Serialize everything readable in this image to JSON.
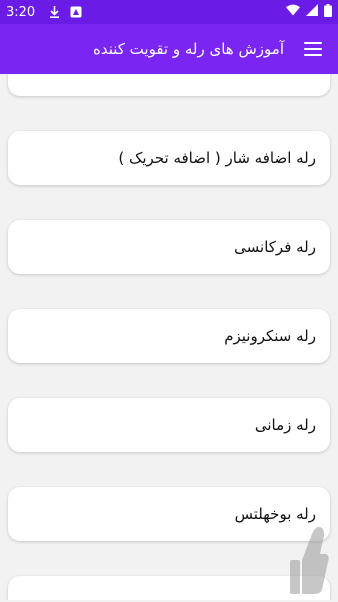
{
  "status_bar": {
    "time": "3:20",
    "icons": [
      "download-icon",
      "app-notification-icon",
      "wifi-icon",
      "signal-icon",
      "battery-icon"
    ]
  },
  "app_bar": {
    "title": "آموزش های رله و تقویت کننده",
    "menu_icon": "menu-icon",
    "color": "#7b25f2"
  },
  "list": {
    "items": [
      {
        "label": ""
      },
      {
        "label": "رله اضافه شار ( اضافه تحریک )"
      },
      {
        "label": "رله فرکانسی"
      },
      {
        "label": "رله سنکرونیزم"
      },
      {
        "label": "رله زمانی"
      },
      {
        "label": "رله بوخهلتس"
      },
      {
        "label": ""
      }
    ]
  },
  "watermark": {
    "icon": "thumb-up-icon"
  }
}
